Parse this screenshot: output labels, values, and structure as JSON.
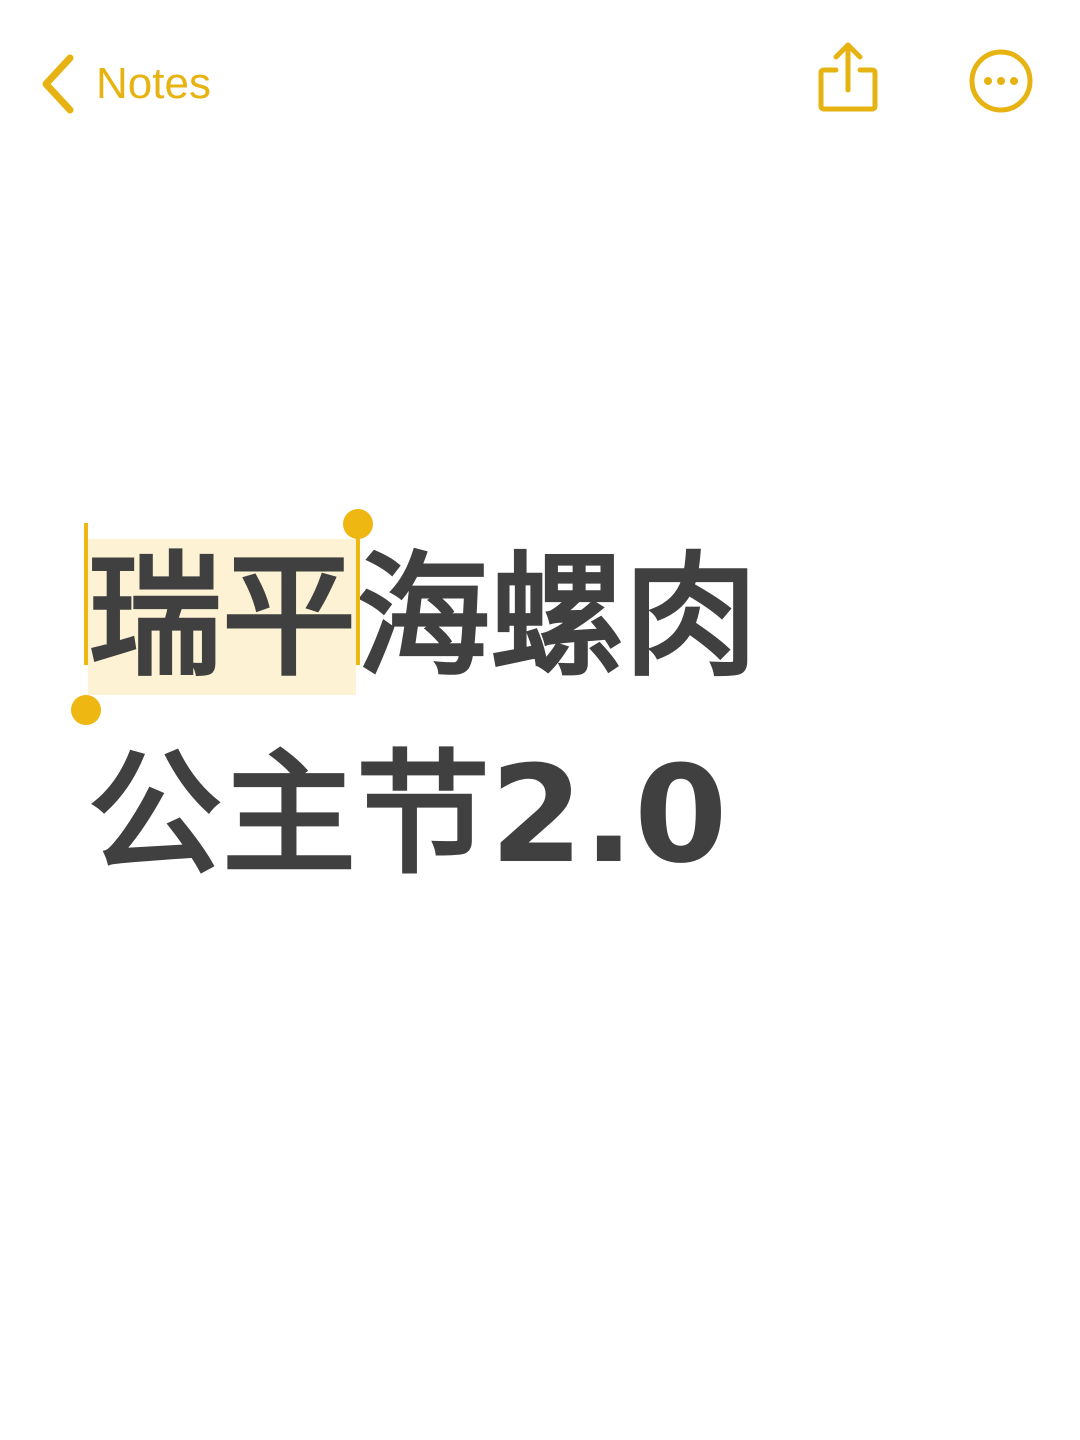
{
  "nav": {
    "back_label": "Notes",
    "back_icon": "chevron-left-icon",
    "share_icon": "share-icon",
    "more_icon": "ellipsis-circle-icon"
  },
  "note": {
    "line1_selected": "瑞平",
    "line1_rest": "海螺肉",
    "line2": "公主节2.0"
  },
  "colors": {
    "accent": "#e6b312",
    "text": "#404040",
    "selection_bg": "#fdf3d4",
    "selection_handle": "#efb712",
    "background": "#ffffff"
  }
}
